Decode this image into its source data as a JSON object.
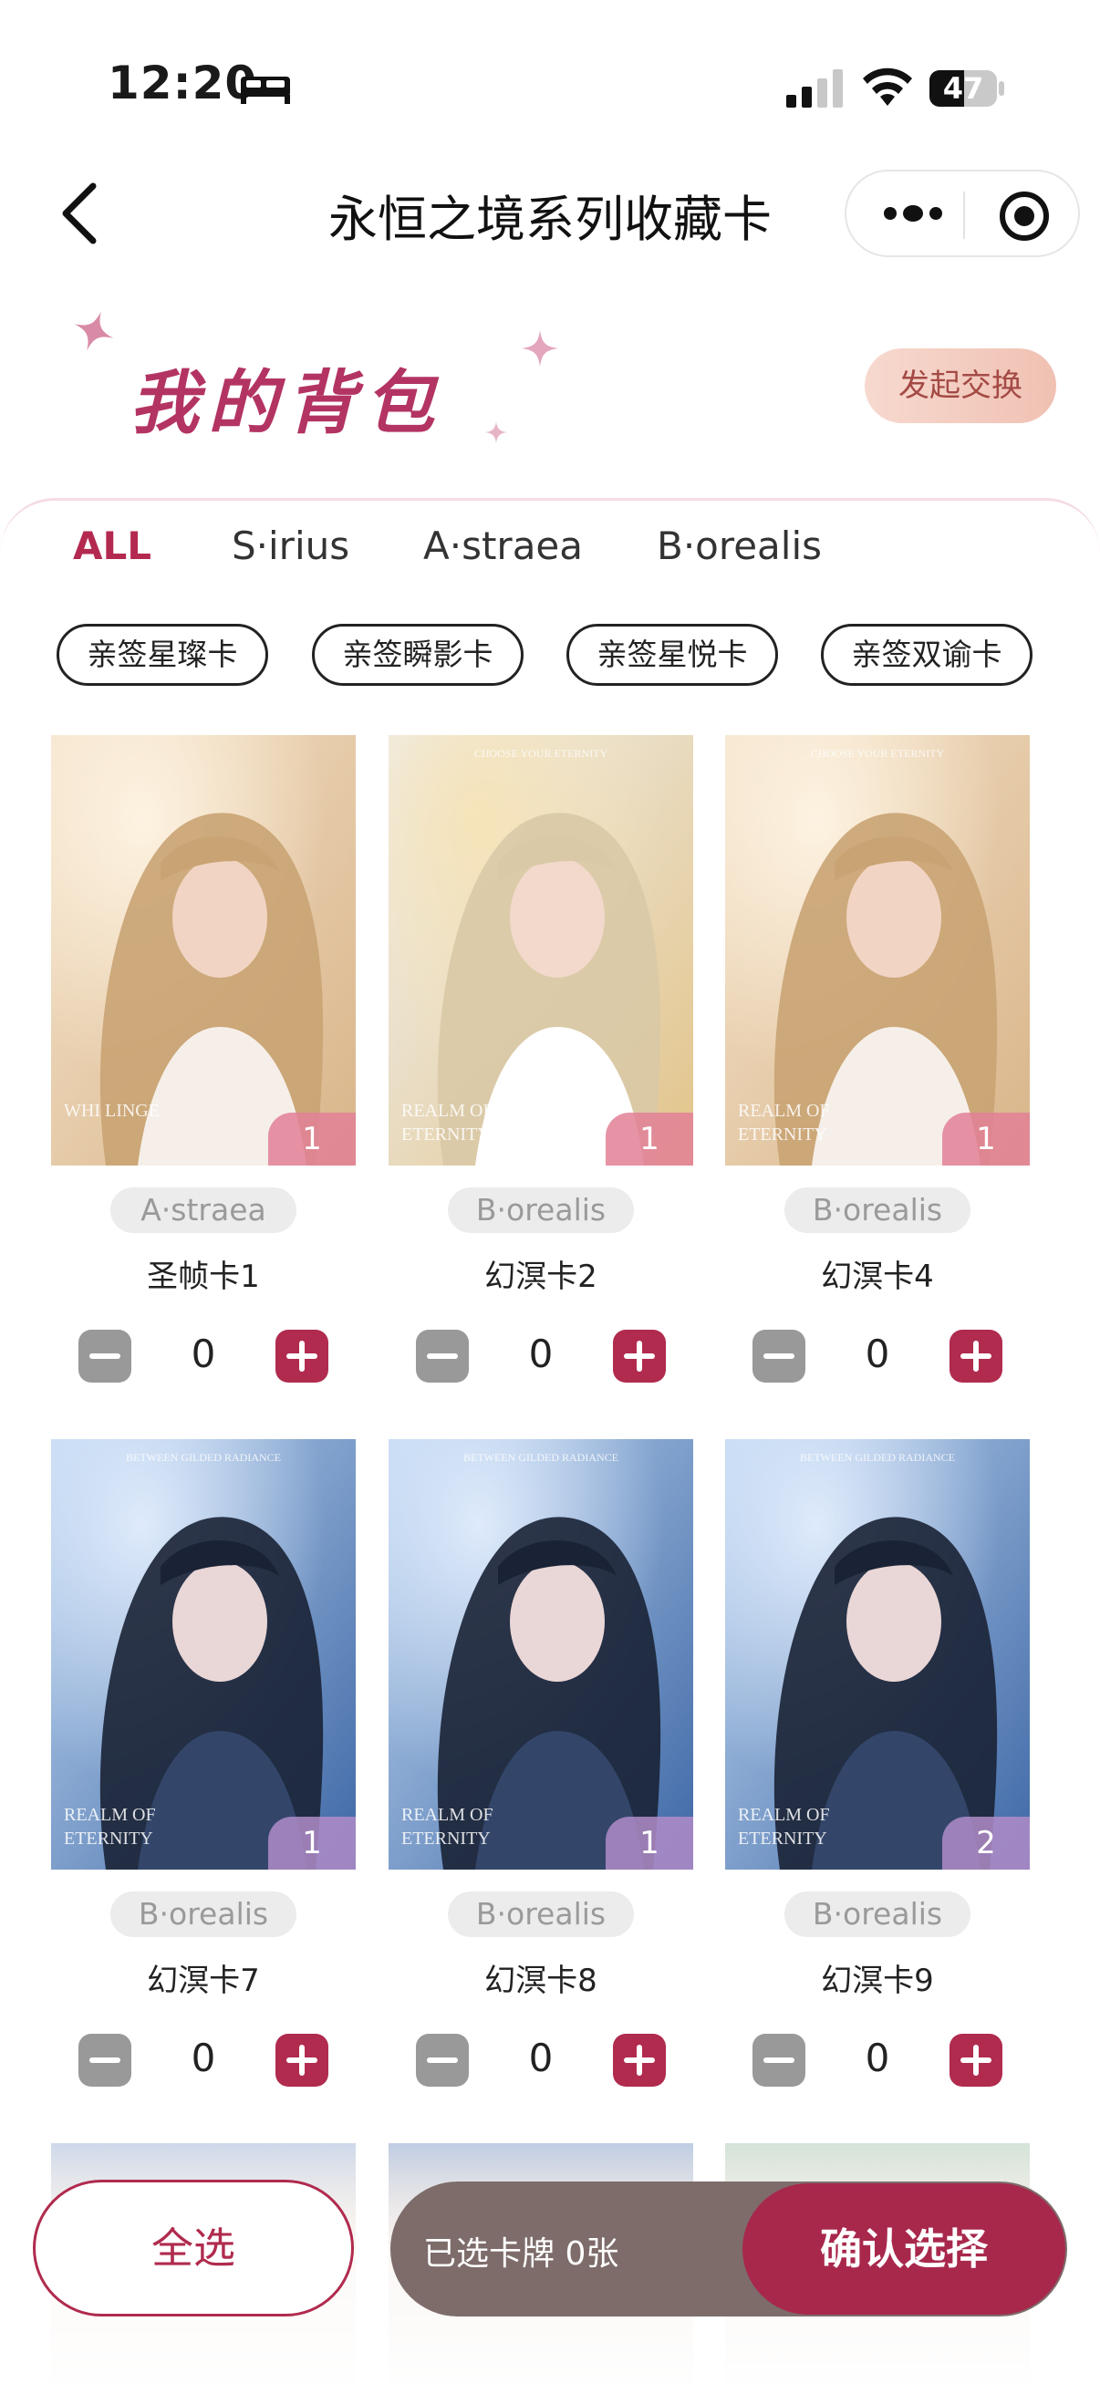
{
  "status_bar": {
    "time": "12:20",
    "battery": "47"
  },
  "nav": {
    "title": "永恒之境系列收藏卡"
  },
  "header": {
    "title": "我的背包",
    "exchange_button": "发起交换"
  },
  "tabs": [
    {
      "label": "ALL",
      "active": true
    },
    {
      "label": "S·irius",
      "active": false
    },
    {
      "label": "A·straea",
      "active": false
    },
    {
      "label": "B·orealis",
      "active": false
    }
  ],
  "chips": [
    "亲签星璨卡",
    "亲签瞬影卡",
    "亲签星悦卡",
    "亲签双谕卡"
  ],
  "cards": [
    {
      "name": "圣帧卡1",
      "tag": "A·straea",
      "count": "1",
      "qty": "0",
      "theme": "warm",
      "overlay": "WHI LINGE"
    },
    {
      "name": "幻溟卡2",
      "tag": "B·orealis",
      "count": "1",
      "qty": "0",
      "theme": "blonde",
      "overlay": "REALM OF ETERNITY",
      "top_text": "CHOOSE YOUR ETERNITY"
    },
    {
      "name": "幻溟卡4",
      "tag": "B·orealis",
      "count": "1",
      "qty": "0",
      "theme": "warm",
      "overlay": "REALM OF ETERNITY",
      "top_text": "CHOOSE YOUR ETERNITY"
    },
    {
      "name": "幻溟卡7",
      "tag": "B·orealis",
      "count": "1",
      "qty": "0",
      "theme": "blue",
      "overlay": "REALM OF ETERNITY",
      "top_text": "BETWEEN GILDED RADIANCE"
    },
    {
      "name": "幻溟卡8",
      "tag": "B·orealis",
      "count": "1",
      "qty": "0",
      "theme": "blue",
      "overlay": "REALM OF ETERNITY",
      "top_text": "BETWEEN GILDED RADIANCE"
    },
    {
      "name": "幻溟卡9",
      "tag": "B·orealis",
      "count": "2",
      "qty": "0",
      "theme": "blue",
      "overlay": "REALM OF ETERNITY",
      "top_text": "BETWEEN GILDED RADIANCE"
    }
  ],
  "bottom": {
    "select_all": "全选",
    "selected_text": "已选卡牌 0张",
    "confirm": "确认选择"
  },
  "colors": {
    "accent": "#b02b4e",
    "header_title": "#b33463",
    "bar_bg": "#7d6c6a"
  }
}
